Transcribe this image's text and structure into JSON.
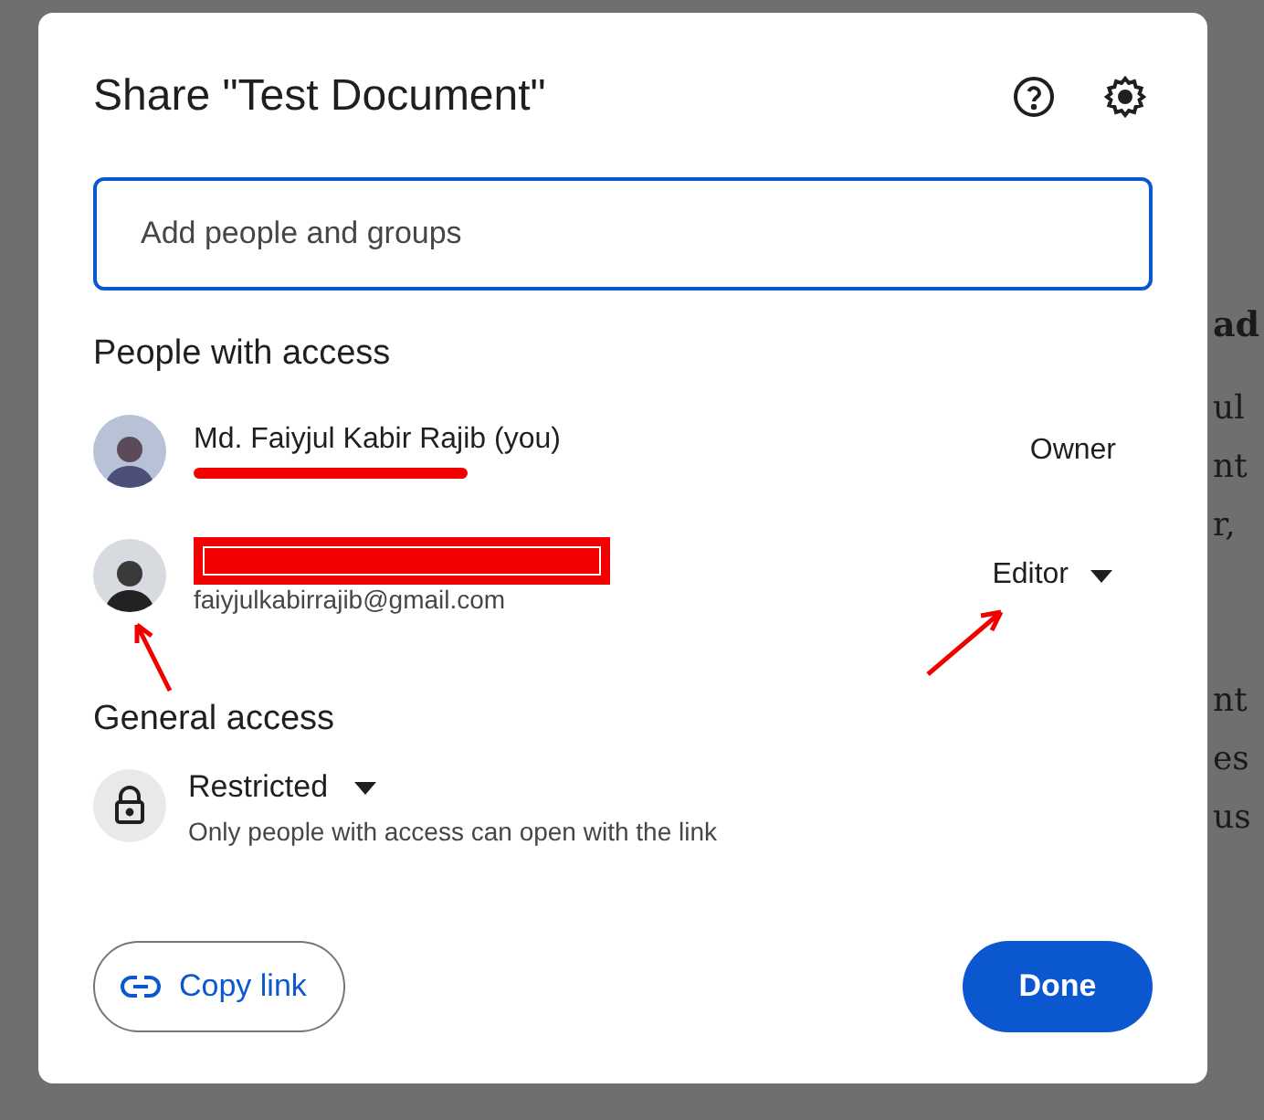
{
  "dialog": {
    "title": "Share \"Test Document\"",
    "search": {
      "placeholder": "Add people and groups"
    },
    "people_heading": "People with access",
    "people": [
      {
        "kind": "underlined",
        "name": "Md. Faiyjul Kabir Rajib (you)",
        "role": "Owner",
        "dropdown": false
      },
      {
        "kind": "boxed",
        "email": "faiyjulkabirrajib@gmail.com",
        "role": "Editor",
        "dropdown": true
      }
    ],
    "general_heading": "General access",
    "general": {
      "setting": "Restricted",
      "description": "Only people with access can open with the link"
    },
    "copy_link": "Copy link",
    "done": "Done"
  },
  "document_fragments": [
    {
      "kind": "heading",
      "text": "ad"
    },
    {
      "kind": "body",
      "text": "ul"
    },
    {
      "kind": "body",
      "text": "nt"
    },
    {
      "kind": "body",
      "text": "r,"
    },
    {
      "kind": "gap"
    },
    {
      "kind": "body",
      "text": "nt"
    },
    {
      "kind": "body",
      "text": "es"
    },
    {
      "kind": "body",
      "text": "us"
    }
  ]
}
